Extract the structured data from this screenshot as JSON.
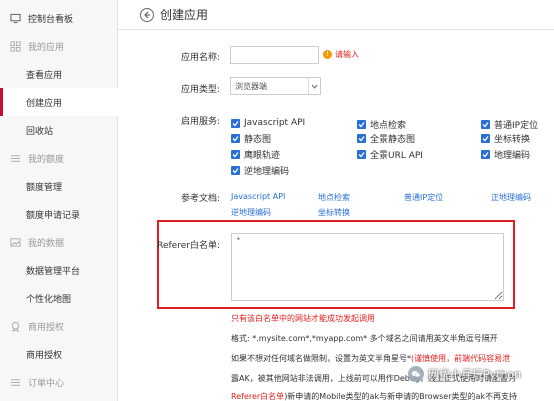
{
  "sidebar": {
    "items": [
      {
        "label": "控制台看板",
        "icon": "monitor-icon"
      },
      {
        "label": "我的应用",
        "icon": "grid-icon"
      },
      {
        "label": "查看应用"
      },
      {
        "label": "创建应用"
      },
      {
        "label": "回收站"
      },
      {
        "label": "我的额度",
        "icon": "list-icon"
      },
      {
        "label": "额度管理"
      },
      {
        "label": "额度申请记录"
      },
      {
        "label": "我的数据",
        "icon": "image-icon"
      },
      {
        "label": "数据管理平台"
      },
      {
        "label": "个性化地图"
      },
      {
        "label": "商用授权",
        "icon": "badge-icon"
      },
      {
        "label": "商用授权"
      },
      {
        "label": "订单中心",
        "icon": "list-icon"
      }
    ],
    "active_color": "#c8102e"
  },
  "header": {
    "title": "创建应用"
  },
  "form": {
    "app_name": {
      "label": "应用名称:",
      "value": "",
      "error": "请输入",
      "error_icon": "!"
    },
    "app_type": {
      "label": "应用类型:",
      "value": "浏览器端"
    },
    "services": {
      "label": "启用服务:",
      "items": [
        {
          "label": "Javascript API",
          "checked": true
        },
        {
          "label": "地点检索",
          "checked": true
        },
        {
          "label": "普通IP定位",
          "checked": true
        },
        {
          "label": "静态图",
          "checked": true
        },
        {
          "label": "全景静态图",
          "checked": true
        },
        {
          "label": "坐标转换",
          "checked": true
        },
        {
          "label": "鹰眼轨迹",
          "checked": true
        },
        {
          "label": "全景URL API",
          "checked": true
        },
        {
          "label": "地理编码",
          "checked": true
        },
        {
          "label": "逆地理编码",
          "checked": true
        }
      ]
    },
    "docs": {
      "label": "参考文档:",
      "links": [
        "Javascript API",
        "地点检索",
        "普通IP定位",
        "正地理编码",
        "逆地理编码",
        "坐标转换"
      ]
    },
    "referer": {
      "label": "Referer白名单:",
      "value": "*"
    },
    "notes": {
      "warning": "只有该白名单中的网站才能成功发起调用",
      "format": "格式: *.mysite.com*,*myapp.com* 多个域名之间请用英文半角逗号隔开",
      "line3_normal": "如果不想对任何域名做限制，设置为英文半角星号*",
      "line3_red": "(谨慎使用，前端代码容易泄",
      "line4_red": "露AK，被其他网站非法调用，上线前可以用作Debug，线上正式使用时请配置为",
      "line5_red": "Referer白名单",
      "line5_normal": ")新申请的Mobile类型的ak与新申请的Browser类型的ak不再支持"
    }
  },
  "watermark": {
    "text": "网优小兵玩Python",
    "icon": "wechat-icon"
  },
  "colors": {
    "link": "#2a6fd6",
    "error": "#e02020",
    "checkbox": "#2a6fd6",
    "highlight_border": "#e02020"
  }
}
